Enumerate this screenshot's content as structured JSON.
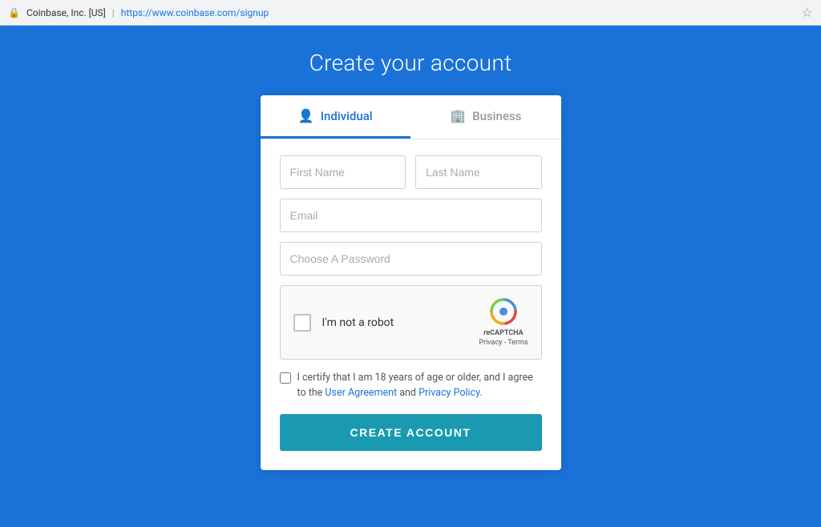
{
  "browser": {
    "lock_icon": "🔒",
    "site_name": "Coinbase, Inc. [US]",
    "separator": "|",
    "url": "https://www.coinbase.com/signup",
    "star_icon": "☆"
  },
  "page": {
    "title": "Create your account"
  },
  "tabs": [
    {
      "id": "individual",
      "label": "Individual",
      "active": true
    },
    {
      "id": "business",
      "label": "Business",
      "active": false
    }
  ],
  "form": {
    "first_name_placeholder": "First Name",
    "last_name_placeholder": "Last Name",
    "email_placeholder": "Email",
    "password_placeholder": "Choose A Password",
    "recaptcha_label": "I'm not a robot",
    "recaptcha_brand": "reCAPTCHA",
    "recaptcha_subtext": "Privacy - Terms",
    "certify_text": "I certify that I am 18 years of age or older, and I agree to the",
    "user_agreement_label": "User Agreement",
    "certify_and": "and",
    "privacy_policy_label": "Privacy Policy",
    "create_account_label": "CREATE ACCOUNT"
  }
}
